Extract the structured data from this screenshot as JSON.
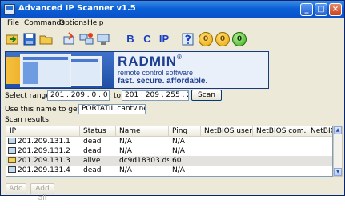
{
  "window": {
    "title": "Advanced IP Scanner v1.5"
  },
  "titlebar_buttons": {
    "minimize": "_",
    "maximize": "□",
    "close": "×"
  },
  "menu": [
    "File",
    "Commands",
    "Options",
    "Help"
  ],
  "toolbar": {
    "letters": [
      "B",
      "C",
      "IP"
    ],
    "coins": [
      "0",
      "0",
      "0"
    ]
  },
  "banner": {
    "logo": "RADMIN",
    "registered": "®",
    "tagline": "remote control software",
    "slogan": "fast. secure. affordable."
  },
  "range": {
    "label": "Select range:",
    "from": "201 . 209 .   0  .  0",
    "to_label": "to",
    "to": "201 . 209 . 255 . 255",
    "scan_label": "Scan"
  },
  "name_lookup": {
    "label": "Use this name to get IP:",
    "value": "PORTATIL.cantv.net"
  },
  "results": {
    "label": "Scan results:",
    "columns": [
      "IP",
      "Status",
      "Name",
      "Ping",
      "NetBIOS user",
      "NetBIOS com...",
      "NetBIOS"
    ],
    "rows": [
      {
        "ip": "201.209.131.1",
        "status": "dead",
        "name": "N/A",
        "ping": "N/A",
        "alive": false
      },
      {
        "ip": "201.209.131.2",
        "status": "dead",
        "name": "N/A",
        "ping": "N/A",
        "alive": false
      },
      {
        "ip": "201.209.131.3",
        "status": "alive",
        "name": "dc9d18303.dsl...",
        "ping": "60",
        "alive": true
      },
      {
        "ip": "201.209.131.4",
        "status": "dead",
        "name": "N/A",
        "ping": "N/A",
        "alive": false
      }
    ]
  },
  "footer": {
    "add_label": "Add",
    "add_all_label": "Add all"
  }
}
